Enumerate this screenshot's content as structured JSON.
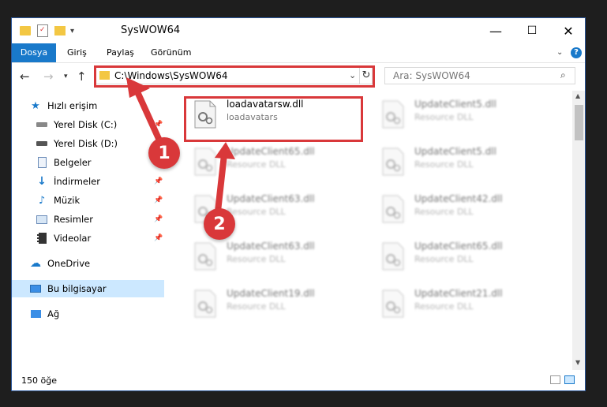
{
  "window": {
    "title": "SysWOW64",
    "controls": {
      "minimize": "—",
      "maximize": "☐",
      "close": "✕"
    }
  },
  "ribbon": {
    "tabs": [
      "Dosya",
      "Giriş",
      "Paylaş",
      "Görünüm"
    ],
    "help": "?"
  },
  "address": {
    "path": "C:\\Windows\\SysWOW64",
    "search_placeholder": "Ara: SysWOW64"
  },
  "sidebar": {
    "items": [
      {
        "label": "Hızlı erişim",
        "icon": "star-icon",
        "pinned": false
      },
      {
        "label": "Yerel Disk (C:)",
        "icon": "drive-icon",
        "pinned": true
      },
      {
        "label": "Yerel Disk (D:)",
        "icon": "drive-icon",
        "pinned": true
      },
      {
        "label": "Belgeler",
        "icon": "documents-icon",
        "pinned": true
      },
      {
        "label": "İndirmeler",
        "icon": "download-icon",
        "pinned": true
      },
      {
        "label": "Müzik",
        "icon": "music-icon",
        "pinned": true
      },
      {
        "label": "Resimler",
        "icon": "pictures-icon",
        "pinned": true
      },
      {
        "label": "Videolar",
        "icon": "video-icon",
        "pinned": true
      },
      {
        "label": "OneDrive",
        "icon": "cloud-icon",
        "pinned": false
      },
      {
        "label": "Bu bilgisayar",
        "icon": "computer-icon",
        "pinned": false
      },
      {
        "label": "Ağ",
        "icon": "network-icon",
        "pinned": false
      }
    ]
  },
  "files": [
    {
      "name": "loadavatarsw.dll",
      "desc": "loadavatars"
    },
    {
      "name": "UpdateClient5.dll",
      "desc": "Resource DLL"
    },
    {
      "name": "UpdateClient65.dll",
      "desc": "Resource DLL"
    },
    {
      "name": "UpdateClient5.dll",
      "desc": "Resource DLL"
    },
    {
      "name": "UpdateClient63.dll",
      "desc": "Resource DLL"
    },
    {
      "name": "UpdateClient42.dll",
      "desc": "Resource DLL"
    },
    {
      "name": "UpdateClient63.dll",
      "desc": "Resource DLL"
    },
    {
      "name": "UpdateClient65.dll",
      "desc": "Resource DLL"
    },
    {
      "name": "UpdateClient19.dll",
      "desc": "Resource DLL"
    },
    {
      "name": "UpdateClient21.dll",
      "desc": "Resource DLL"
    }
  ],
  "status": {
    "count": "150 öğe"
  },
  "callouts": [
    "1",
    "2"
  ],
  "colors": {
    "accent": "#1979ca",
    "highlight": "#d9383a",
    "selected": "#cce8ff"
  }
}
